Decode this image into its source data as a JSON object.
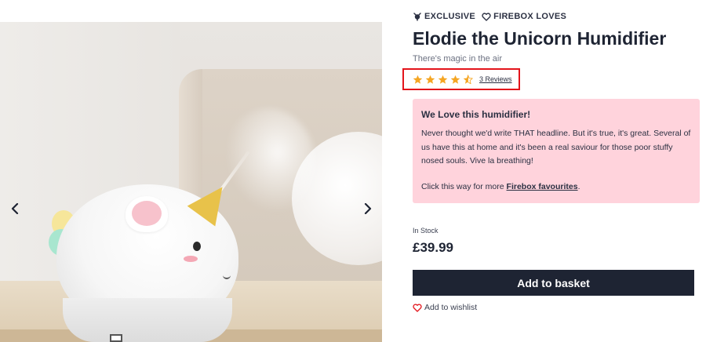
{
  "product": {
    "badges": [
      {
        "label": "EXCLUSIVE",
        "icon": "unicorn-badge-icon"
      },
      {
        "label": "FIREBOX LOVES",
        "icon": "heart-outline-icon"
      }
    ],
    "title": "Elodie the Unicorn Humidifier",
    "subtitle": "There's magic in the air",
    "rating": {
      "value": 4.5,
      "max": 5,
      "reviews_label": "3 Reviews",
      "star_color": "#f5a623",
      "highlight_color": "#e3141b"
    },
    "love_box": {
      "heading": "We Love this humidifier!",
      "body": "Never thought we'd write THAT headline. But it's true, it's great. Several of us have this at home and it's been a real saviour for those poor stuffy nosed souls. Vive la breathing!",
      "cta_prefix": "Click this way for more ",
      "cta_link": "Firebox favourites",
      "cta_suffix": ".",
      "background": "#ffd3dc"
    },
    "stock_status": "In Stock",
    "price": "£39.99",
    "add_to_basket_label": "Add to basket",
    "wishlist_label": "Add to wishlist",
    "primary_color": "#1e2433"
  },
  "gallery": {
    "prev_icon": "chevron-left-icon",
    "next_icon": "chevron-right-icon"
  }
}
